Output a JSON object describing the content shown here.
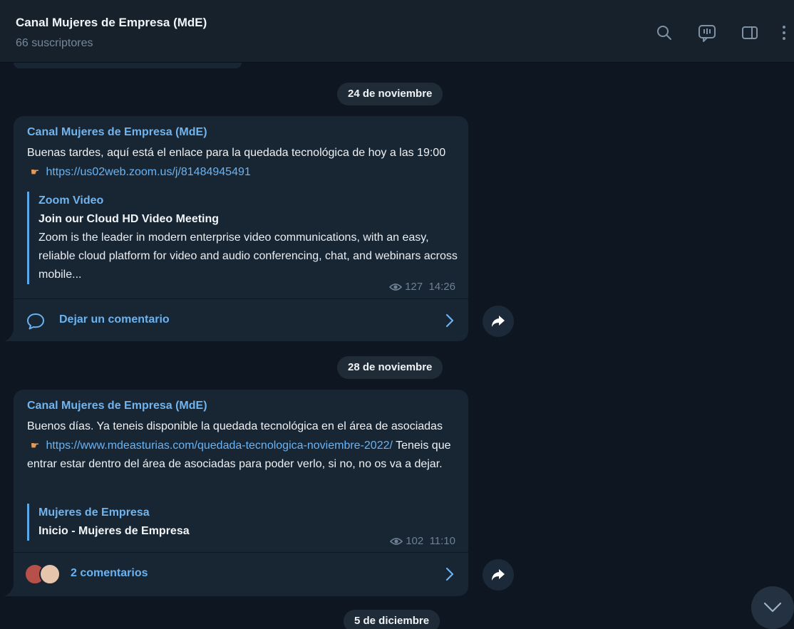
{
  "header": {
    "title": "Canal Mujeres de Empresa (MdE)",
    "subtitle": "66 suscriptores",
    "icons": [
      "search-icon",
      "comments-icon",
      "sidebar-toggle-icon",
      "more-vertical-icon"
    ]
  },
  "messages": [
    {
      "date": "24 de noviembre",
      "author": "Canal Mujeres de Empresa (MdE)",
      "text_before_link": "Buenas tardes, aquí está el enlace para la quedada tecnológica de hoy a las 19:00 ",
      "link": "https://us02web.zoom.us/j/81484945491",
      "text_after_link": "",
      "preview_site": "Zoom Video",
      "preview_title": "Join our Cloud HD Video Meeting",
      "preview_desc": "Zoom is the leader in modern enterprise video communications, with an easy, reliable cloud platform for video and audio conferencing, chat, and webinars across mobile...",
      "views": "127",
      "time": "14:26",
      "comments_label": "Dejar un comentario"
    },
    {
      "date": "28 de noviembre",
      "author": "Canal Mujeres de Empresa (MdE)",
      "text_before_link": "Buenos días. Ya teneis disponible la quedada tecnológica en el área de asociadas ",
      "link": "https://www.mdeasturias.com/quedada-tecnologica-noviembre-2022/",
      "text_after_link": "  Teneis que entrar estar dentro del área de asociadas para poder verlo, si no, no os va a dejar.",
      "preview_site": "Mujeres de Empresa",
      "preview_title": "Inicio - Mujeres de Empresa",
      "preview_desc": "",
      "views": "102",
      "time": "11:10",
      "comments_label": "2 comentarios"
    }
  ],
  "next_date": "5 de diciembre",
  "colors": {
    "background": "#0e1621",
    "header": "#17212b",
    "bubble": "#182533",
    "accent": "#71b4ee",
    "link": "#68b4f5",
    "meta": "#6e8194"
  }
}
